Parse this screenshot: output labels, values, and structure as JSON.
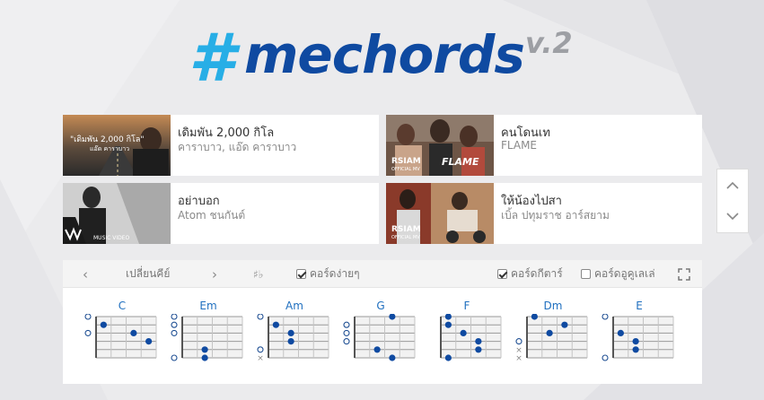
{
  "logo": {
    "hash": "#",
    "word": "mechords",
    "version": "v.2"
  },
  "songs": [
    {
      "title": "เดิมพัน 2,000 กิโล",
      "artist": "คาราบาว, แอ๊ด คาราบาว",
      "thumb_caption": "\"เดิมพัน 2,000 กิโล\"",
      "thumb_sub": "แอ๊ด คาราบาว"
    },
    {
      "title": "คนโดนเท",
      "artist": "FLAME",
      "thumb_caption": "RSIAM",
      "thumb_sub": "OFFICIAL MV",
      "thumb_logo": "FLAME"
    },
    {
      "title": "อย่าบอก",
      "artist": "Atom ชนกันต์",
      "thumb_caption": "MUSIC VIDEO",
      "thumb_sub": ""
    },
    {
      "title": "ให้น้องไปสา",
      "artist": "เบิ้ล ปทุมราช อาร์สยาม",
      "thumb_caption": "RSIAM",
      "thumb_sub": "OFFICIAL MV"
    }
  ],
  "scroll": {
    "up_icon": "chevron-up-icon",
    "down_icon": "chevron-down-icon"
  },
  "toolbar": {
    "prev_key": "‹",
    "change_key_label": "เปลี่ยนคีย์",
    "next_key": "›",
    "sharp_flat": "♯♭",
    "easy_chords_label": "คอร์ดง่ายๆ",
    "easy_chords_checked": true,
    "guitar_chords_label": "คอร์ดกีตาร์",
    "guitar_chords_checked": true,
    "ukulele_chords_label": "คอร์ดอูคูเลเล่",
    "ukulele_chords_checked": false,
    "fullscreen_icon": "fullscreen-icon"
  },
  "chords": [
    {
      "name": "C",
      "markers": [
        "o",
        "",
        "o",
        "",
        "",
        ""
      ],
      "dots": [
        [
          1,
          1
        ],
        [
          2,
          3
        ],
        [
          3,
          4
        ]
      ]
    },
    {
      "name": "Em",
      "markers": [
        "o",
        "o",
        "o",
        "",
        "",
        "o"
      ],
      "dots": [
        [
          4,
          2
        ],
        [
          5,
          2
        ]
      ]
    },
    {
      "name": "Am",
      "markers": [
        "o",
        "",
        "",
        "",
        "o",
        "x"
      ],
      "dots": [
        [
          1,
          1
        ],
        [
          2,
          2
        ],
        [
          3,
          2
        ]
      ]
    },
    {
      "name": "G",
      "markers": [
        "",
        "o",
        "o",
        "o",
        "",
        ""
      ],
      "dots": [
        [
          0,
          3
        ],
        [
          4,
          2
        ],
        [
          5,
          3
        ]
      ]
    },
    {
      "name": "F",
      "markers": [
        "",
        "",
        "",
        "",
        "",
        ""
      ],
      "dots": [
        [
          0,
          1
        ],
        [
          1,
          1
        ],
        [
          2,
          2
        ],
        [
          3,
          3
        ],
        [
          4,
          3
        ],
        [
          5,
          1
        ]
      ]
    },
    {
      "name": "Dm",
      "markers": [
        "",
        "",
        "",
        "o",
        "x",
        "x"
      ],
      "dots": [
        [
          0,
          1
        ],
        [
          1,
          3
        ],
        [
          2,
          2
        ]
      ]
    },
    {
      "name": "E",
      "markers": [
        "o",
        "",
        "",
        "",
        "",
        "o"
      ],
      "dots": [
        [
          2,
          1
        ],
        [
          3,
          2
        ],
        [
          4,
          2
        ]
      ]
    }
  ],
  "colors": {
    "accent_blue": "#0f4aa1",
    "hash_blue": "#27aee6",
    "dot_blue": "#0f4aa1"
  }
}
